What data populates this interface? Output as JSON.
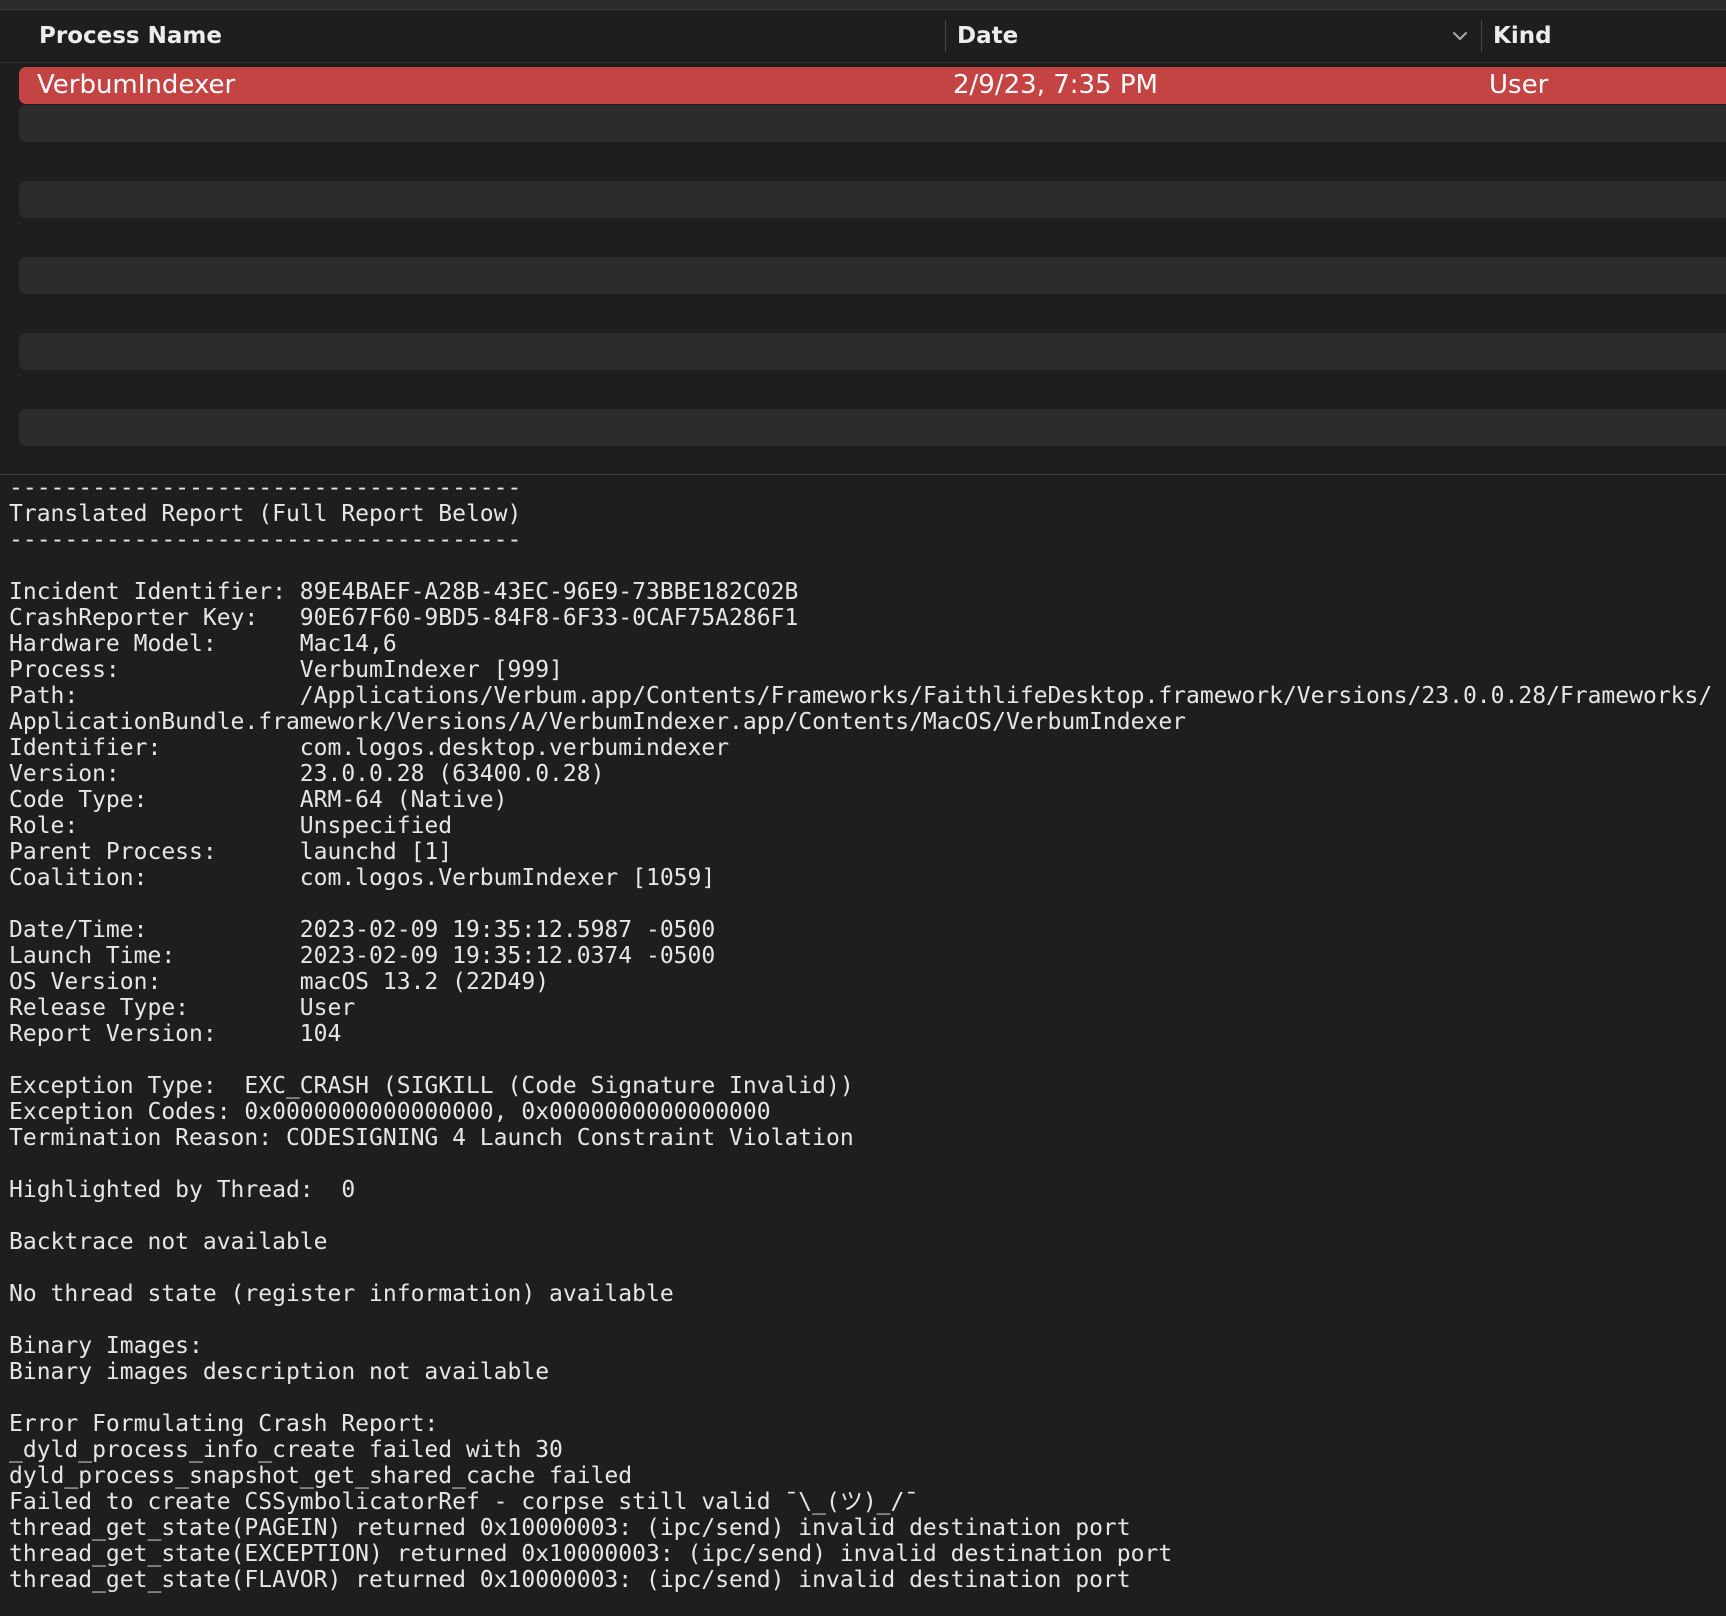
{
  "table": {
    "columns": {
      "process_name": "Process Name",
      "date": "Date",
      "kind": "Kind"
    },
    "sort_icon": "chevron-down-icon",
    "rows": [
      {
        "process_name": "VerbumIndexer",
        "date": "2/9/23, 7:35 PM",
        "kind": "User",
        "selected": true
      }
    ]
  },
  "colors": {
    "selection": "#c44343",
    "stripe": "#2b2b2b",
    "background": "#1e1e1e"
  },
  "report": {
    "lines": [
      "-------------------------------------",
      "Translated Report (Full Report Below)",
      "-------------------------------------",
      "",
      "Incident Identifier: 89E4BAEF-A28B-43EC-96E9-73BBE182C02B",
      "CrashReporter Key:   90E67F60-9BD5-84F8-6F33-0CAF75A286F1",
      "Hardware Model:      Mac14,6",
      "Process:             VerbumIndexer [999]",
      "Path:                /Applications/Verbum.app/Contents/Frameworks/FaithlifeDesktop.framework/Versions/23.0.0.28/Frameworks/",
      "ApplicationBundle.framework/Versions/A/VerbumIndexer.app/Contents/MacOS/VerbumIndexer",
      "Identifier:          com.logos.desktop.verbumindexer",
      "Version:             23.0.0.28 (63400.0.28)",
      "Code Type:           ARM-64 (Native)",
      "Role:                Unspecified",
      "Parent Process:      launchd [1]",
      "Coalition:           com.logos.VerbumIndexer [1059]",
      "",
      "Date/Time:           2023-02-09 19:35:12.5987 -0500",
      "Launch Time:         2023-02-09 19:35:12.0374 -0500",
      "OS Version:          macOS 13.2 (22D49)",
      "Release Type:        User",
      "Report Version:      104",
      "",
      "Exception Type:  EXC_CRASH (SIGKILL (Code Signature Invalid))",
      "Exception Codes: 0x0000000000000000, 0x0000000000000000",
      "Termination Reason: CODESIGNING 4 Launch Constraint Violation",
      "",
      "Highlighted by Thread:  0",
      "",
      "Backtrace not available",
      "",
      "No thread state (register information) available",
      "",
      "Binary Images:",
      "Binary images description not available",
      "",
      "Error Formulating Crash Report:",
      "_dyld_process_info_create failed with 30",
      "dyld_process_snapshot_get_shared_cache failed",
      "Failed to create CSSymbolicatorRef - corpse still valid ¯\\_(ツ)_/¯",
      "thread_get_state(PAGEIN) returned 0x10000003: (ipc/send) invalid destination port",
      "thread_get_state(EXCEPTION) returned 0x10000003: (ipc/send) invalid destination port",
      "thread_get_state(FLAVOR) returned 0x10000003: (ipc/send) invalid destination port"
    ]
  }
}
